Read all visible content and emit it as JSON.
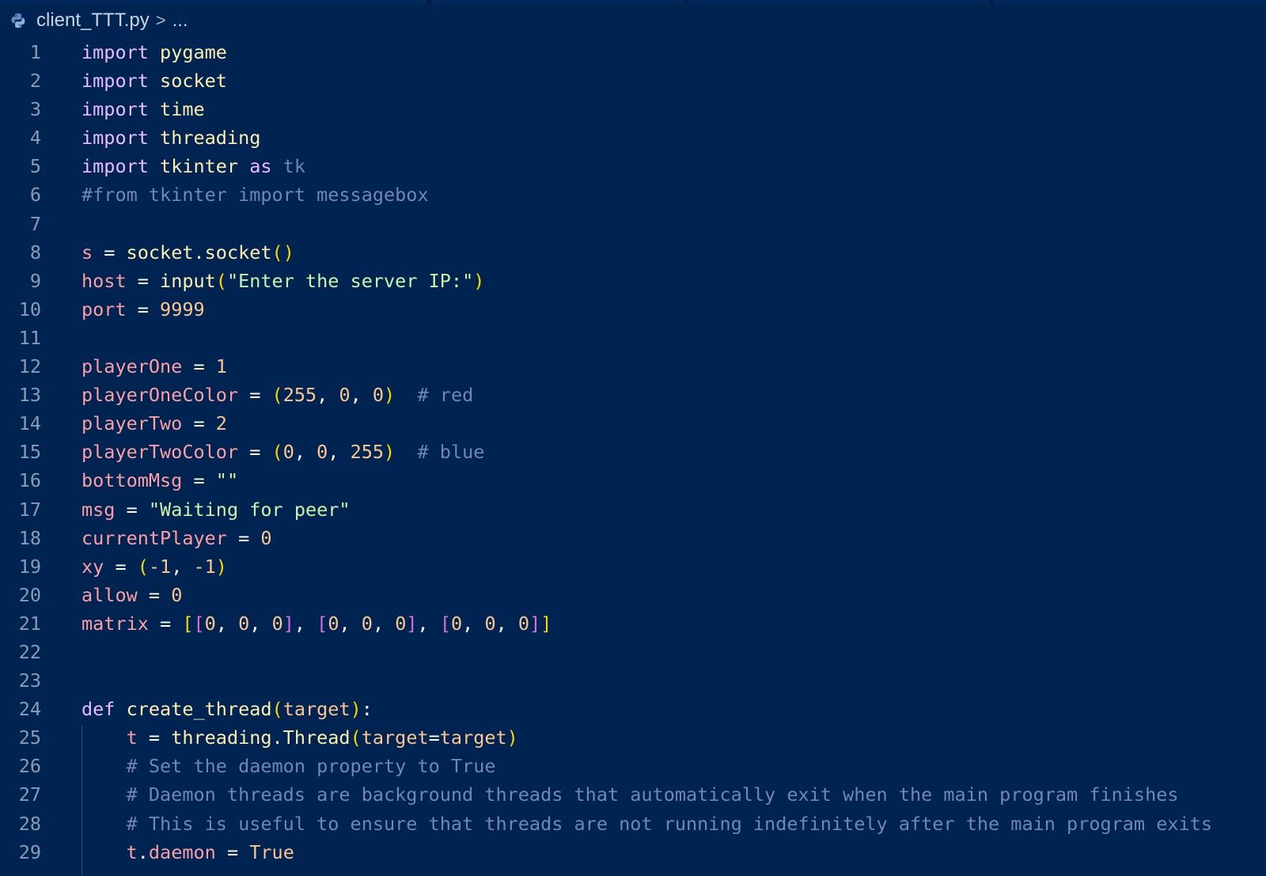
{
  "breadcrumb": {
    "file": "client_TTT.py",
    "separator": ">",
    "more": "..."
  },
  "icons": {
    "file_icon": "python-icon",
    "breadcrumb_separator": "chevron-right-icon"
  },
  "colors": {
    "background": "#002451",
    "keyword": "#ebbbff",
    "variable": "#ff9da4",
    "string": "#d1f1a9",
    "number": "#ffc58f",
    "comment": "#7285b7",
    "function": "#ffeead",
    "bracket_level1": "#ffd700",
    "bracket_level2": "#da70d6"
  },
  "lines": [
    {
      "n": "1",
      "tokens": [
        [
          "kw",
          "import"
        ],
        [
          "op",
          " "
        ],
        [
          "mod",
          "pygame"
        ]
      ]
    },
    {
      "n": "2",
      "tokens": [
        [
          "kw",
          "import"
        ],
        [
          "op",
          " "
        ],
        [
          "mod",
          "socket"
        ]
      ]
    },
    {
      "n": "3",
      "tokens": [
        [
          "kw",
          "import"
        ],
        [
          "op",
          " "
        ],
        [
          "mod",
          "time"
        ]
      ]
    },
    {
      "n": "4",
      "tokens": [
        [
          "kw",
          "import"
        ],
        [
          "op",
          " "
        ],
        [
          "mod",
          "threading"
        ]
      ]
    },
    {
      "n": "5",
      "tokens": [
        [
          "kw",
          "import"
        ],
        [
          "op",
          " "
        ],
        [
          "mod",
          "tkinter"
        ],
        [
          "op",
          " "
        ],
        [
          "kw",
          "as"
        ],
        [
          "op",
          " "
        ],
        [
          "cm",
          "tk"
        ]
      ]
    },
    {
      "n": "6",
      "tokens": [
        [
          "cm",
          "#from tkinter import messagebox"
        ]
      ]
    },
    {
      "n": "7",
      "tokens": []
    },
    {
      "n": "8",
      "tokens": [
        [
          "var",
          "s"
        ],
        [
          "op",
          " = "
        ],
        [
          "fn",
          "socket.socket"
        ],
        [
          "p1",
          "()"
        ]
      ]
    },
    {
      "n": "9",
      "tokens": [
        [
          "var",
          "host"
        ],
        [
          "op",
          " = "
        ],
        [
          "fn",
          "input"
        ],
        [
          "p1",
          "("
        ],
        [
          "str",
          "\"Enter the server IP:\""
        ],
        [
          "p1",
          ")"
        ]
      ]
    },
    {
      "n": "10",
      "tokens": [
        [
          "var",
          "port"
        ],
        [
          "op",
          " = "
        ],
        [
          "num",
          "9999"
        ]
      ]
    },
    {
      "n": "11",
      "tokens": []
    },
    {
      "n": "12",
      "tokens": [
        [
          "var",
          "playerOne"
        ],
        [
          "op",
          " = "
        ],
        [
          "num",
          "1"
        ]
      ]
    },
    {
      "n": "13",
      "tokens": [
        [
          "var",
          "playerOneColor"
        ],
        [
          "op",
          " = "
        ],
        [
          "p1",
          "("
        ],
        [
          "num",
          "255"
        ],
        [
          "op",
          ", "
        ],
        [
          "num",
          "0"
        ],
        [
          "op",
          ", "
        ],
        [
          "num",
          "0"
        ],
        [
          "p1",
          ")"
        ],
        [
          "op",
          "  "
        ],
        [
          "cm",
          "# red"
        ]
      ]
    },
    {
      "n": "14",
      "tokens": [
        [
          "var",
          "playerTwo"
        ],
        [
          "op",
          " = "
        ],
        [
          "num",
          "2"
        ]
      ]
    },
    {
      "n": "15",
      "tokens": [
        [
          "var",
          "playerTwoColor"
        ],
        [
          "op",
          " = "
        ],
        [
          "p1",
          "("
        ],
        [
          "num",
          "0"
        ],
        [
          "op",
          ", "
        ],
        [
          "num",
          "0"
        ],
        [
          "op",
          ", "
        ],
        [
          "num",
          "255"
        ],
        [
          "p1",
          ")"
        ],
        [
          "op",
          "  "
        ],
        [
          "cm",
          "# blue"
        ]
      ]
    },
    {
      "n": "16",
      "tokens": [
        [
          "var",
          "bottomMsg"
        ],
        [
          "op",
          " = "
        ],
        [
          "str",
          "\"\""
        ]
      ]
    },
    {
      "n": "17",
      "tokens": [
        [
          "var",
          "msg"
        ],
        [
          "op",
          " = "
        ],
        [
          "str",
          "\"Waiting for peer\""
        ]
      ]
    },
    {
      "n": "18",
      "tokens": [
        [
          "var",
          "currentPlayer"
        ],
        [
          "op",
          " = "
        ],
        [
          "num",
          "0"
        ]
      ]
    },
    {
      "n": "19",
      "tokens": [
        [
          "var",
          "xy"
        ],
        [
          "op",
          " = "
        ],
        [
          "p1",
          "("
        ],
        [
          "num",
          "-1"
        ],
        [
          "op",
          ", "
        ],
        [
          "num",
          "-1"
        ],
        [
          "p1",
          ")"
        ]
      ]
    },
    {
      "n": "20",
      "tokens": [
        [
          "var",
          "allow"
        ],
        [
          "op",
          " = "
        ],
        [
          "num",
          "0"
        ]
      ]
    },
    {
      "n": "21",
      "tokens": [
        [
          "var",
          "matrix"
        ],
        [
          "op",
          " = "
        ],
        [
          "p1",
          "["
        ],
        [
          "p2",
          "["
        ],
        [
          "num",
          "0"
        ],
        [
          "op",
          ", "
        ],
        [
          "num",
          "0"
        ],
        [
          "op",
          ", "
        ],
        [
          "num",
          "0"
        ],
        [
          "p2",
          "]"
        ],
        [
          "op",
          ", "
        ],
        [
          "p2",
          "["
        ],
        [
          "num",
          "0"
        ],
        [
          "op",
          ", "
        ],
        [
          "num",
          "0"
        ],
        [
          "op",
          ", "
        ],
        [
          "num",
          "0"
        ],
        [
          "p2",
          "]"
        ],
        [
          "op",
          ", "
        ],
        [
          "p2",
          "["
        ],
        [
          "num",
          "0"
        ],
        [
          "op",
          ", "
        ],
        [
          "num",
          "0"
        ],
        [
          "op",
          ", "
        ],
        [
          "num",
          "0"
        ],
        [
          "p2",
          "]"
        ],
        [
          "p1",
          "]"
        ]
      ]
    },
    {
      "n": "22",
      "tokens": []
    },
    {
      "n": "23",
      "tokens": []
    },
    {
      "n": "24",
      "tokens": [
        [
          "kw",
          "def"
        ],
        [
          "op",
          " "
        ],
        [
          "fn",
          "create_thread"
        ],
        [
          "p1",
          "("
        ],
        [
          "param",
          "target"
        ],
        [
          "p1",
          ")"
        ],
        [
          "op",
          ":"
        ]
      ]
    },
    {
      "n": "25",
      "tokens": [
        [
          "op",
          "    "
        ],
        [
          "var",
          "t"
        ],
        [
          "op",
          " = "
        ],
        [
          "fn",
          "threading.Thread"
        ],
        [
          "p1",
          "("
        ],
        [
          "param",
          "target"
        ],
        [
          "op",
          "="
        ],
        [
          "param",
          "target"
        ],
        [
          "p1",
          ")"
        ]
      ]
    },
    {
      "n": "26",
      "tokens": [
        [
          "op",
          "    "
        ],
        [
          "cm",
          "# Set the daemon property to True"
        ]
      ]
    },
    {
      "n": "27",
      "tokens": [
        [
          "op",
          "    "
        ],
        [
          "cm",
          "# Daemon threads are background threads that automatically exit when the main program finishes"
        ]
      ]
    },
    {
      "n": "28",
      "tokens": [
        [
          "op",
          "    "
        ],
        [
          "cm",
          "# This is useful to ensure that threads are not running indefinitely after the main program exits"
        ]
      ]
    },
    {
      "n": "29",
      "tokens": [
        [
          "op",
          "    "
        ],
        [
          "var",
          "t"
        ],
        [
          "op",
          "."
        ],
        [
          "var",
          "daemon"
        ],
        [
          "op",
          " = "
        ],
        [
          "num",
          "True"
        ]
      ]
    }
  ]
}
